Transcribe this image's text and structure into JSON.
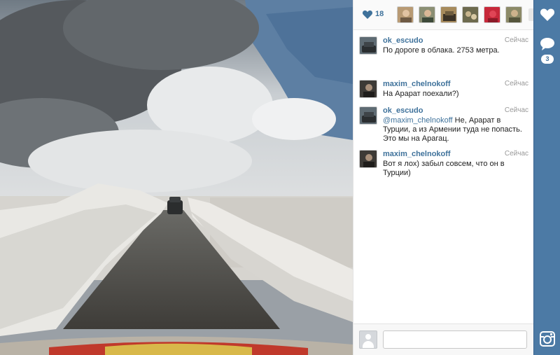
{
  "likes": {
    "count": "18",
    "icon": "heart-icon",
    "likers": [
      "liker-avatar-1",
      "liker-avatar-2",
      "liker-avatar-3",
      "liker-avatar-4",
      "liker-avatar-5",
      "liker-avatar-6"
    ]
  },
  "comments": [
    {
      "user": "ok_escudo",
      "time": "Сейчас",
      "text": "По дороге в облака. 2753 метра."
    },
    {
      "user": "maxim_chelnokoff",
      "time": "Сейчас",
      "text": "На Арарат поехали?)"
    },
    {
      "user": "ok_escudo",
      "time": "Сейчас",
      "mention": "@maxim_chelnokoff",
      "text": " Не, Арарат в Турции, а из Армении туда не попасть. Это мы на Арагац."
    },
    {
      "user": "maxim_chelnokoff",
      "time": "Сейчас",
      "text": "Вот я лох) забыл совсем, что он в Турции)"
    }
  ],
  "compose": {
    "placeholder": ""
  },
  "actions": {
    "like_icon": "heart-icon",
    "comment_icon": "speech-bubble-icon",
    "comment_count": "3",
    "instagram_icon": "instagram-camera-icon"
  },
  "colors": {
    "accent": "#3f729b",
    "action_bar": "#4c7aa5"
  }
}
